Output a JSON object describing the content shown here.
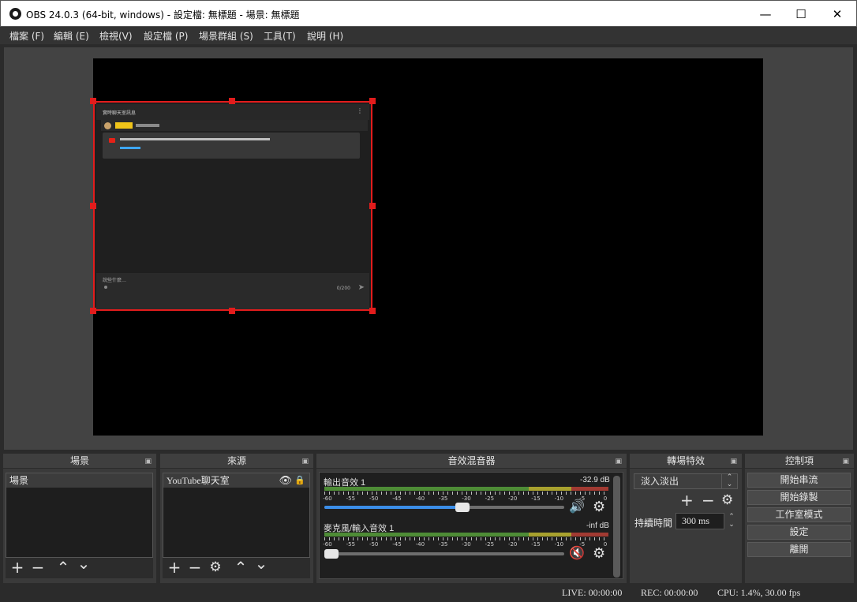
{
  "window": {
    "title": "OBS 24.0.3 (64-bit, windows) - 設定檔: 無標題 - 場景: 無標題",
    "minimize": "—",
    "maximize": "☐",
    "close": "✕"
  },
  "menu": [
    "檔案 (F)",
    "編輯 (E)",
    "檢視(V)",
    "設定檔 (P)",
    "場景群組 (S)",
    "工具(T)",
    "說明 (H)"
  ],
  "preview_source": {
    "header_title": "實時聊天室訊息",
    "input_placeholder": "說些什麼…",
    "char_count": "0/200"
  },
  "docks": {
    "scenes": {
      "title": "場景",
      "items": [
        "場景"
      ]
    },
    "sources": {
      "title": "來源",
      "items": [
        "YouTube聊天室"
      ]
    },
    "mixer": {
      "title": "音效混音器",
      "channels": [
        {
          "name": "輸出音效 1",
          "db": "-32.9 dB",
          "volume": 0.58,
          "muted": false
        },
        {
          "name": "麥克風/輸入音效 1",
          "db": "-inf dB",
          "volume": 0.0,
          "muted": true
        }
      ],
      "scale": [
        "-60",
        "-55",
        "-50",
        "-45",
        "-40",
        "-35",
        "-30",
        "-25",
        "-20",
        "-15",
        "-10",
        "-5",
        "0"
      ]
    },
    "transitions": {
      "title": "轉場特效",
      "selected": "淡入淡出",
      "duration_label": "持續時間",
      "duration_value": "300 ms"
    },
    "controls": {
      "title": "控制項",
      "buttons": [
        "開始串流",
        "開始錄製",
        "工作室模式",
        "設定",
        "離開"
      ]
    }
  },
  "status": {
    "live": "LIVE: 00:00:00",
    "rec": "REC: 00:00:00",
    "cpu": "CPU: 1.4%, 30.00 fps"
  },
  "colors": {
    "selection": "#e21c1c",
    "volume_fill": "#3b8ee8",
    "muted_icon": "#d83333"
  }
}
